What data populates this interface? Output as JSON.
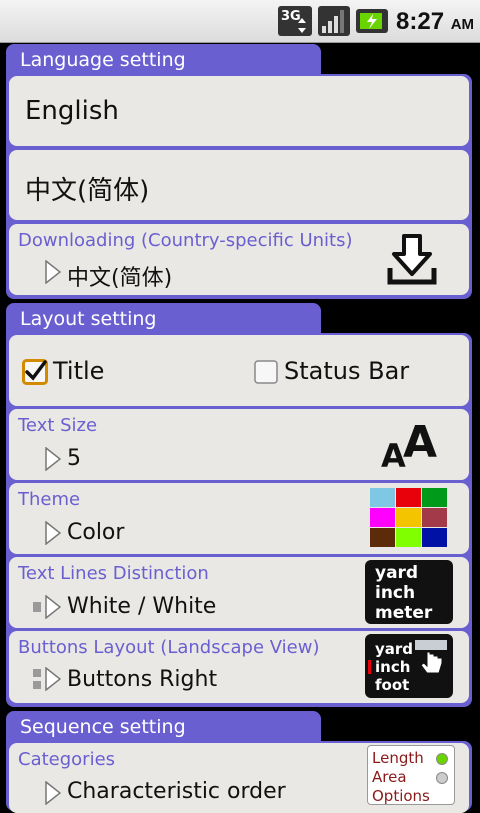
{
  "status_bar": {
    "network": "3G",
    "time": "8:27",
    "ampm": "AM"
  },
  "language": {
    "header": "Language setting",
    "options": [
      "English",
      "中文(简体)"
    ],
    "download": {
      "title": "Downloading (Country-specific Units)",
      "value": "中文(简体)"
    }
  },
  "layout": {
    "header": "Layout setting",
    "title_label": "Title",
    "title_checked": true,
    "statusbar_label": "Status Bar",
    "statusbar_checked": false,
    "text_size": {
      "title": "Text Size",
      "value": "5",
      "icon_text": "AA"
    },
    "theme": {
      "title": "Theme",
      "value": "Color",
      "swatches": [
        "#7ec8e3",
        "#e8000a",
        "#009a1a",
        "#ff00ff",
        "#f5c400",
        "#a23a4a",
        "#5b2b0a",
        "#7fff00",
        "#0012a6"
      ]
    },
    "lines": {
      "title": "Text Lines Distinction",
      "value": "White / White",
      "icon_lines": [
        "yard",
        "inch",
        "meter"
      ]
    },
    "buttons": {
      "title": "Buttons Layout (Landscape View)",
      "value": "Buttons Right",
      "icon_lines": [
        "yard",
        "inch",
        "foot"
      ]
    }
  },
  "sequence": {
    "header": "Sequence setting",
    "categories": {
      "title": "Categories",
      "value": "Characteristic order",
      "icon_items": [
        "Length",
        "Area",
        "Options"
      ]
    }
  }
}
